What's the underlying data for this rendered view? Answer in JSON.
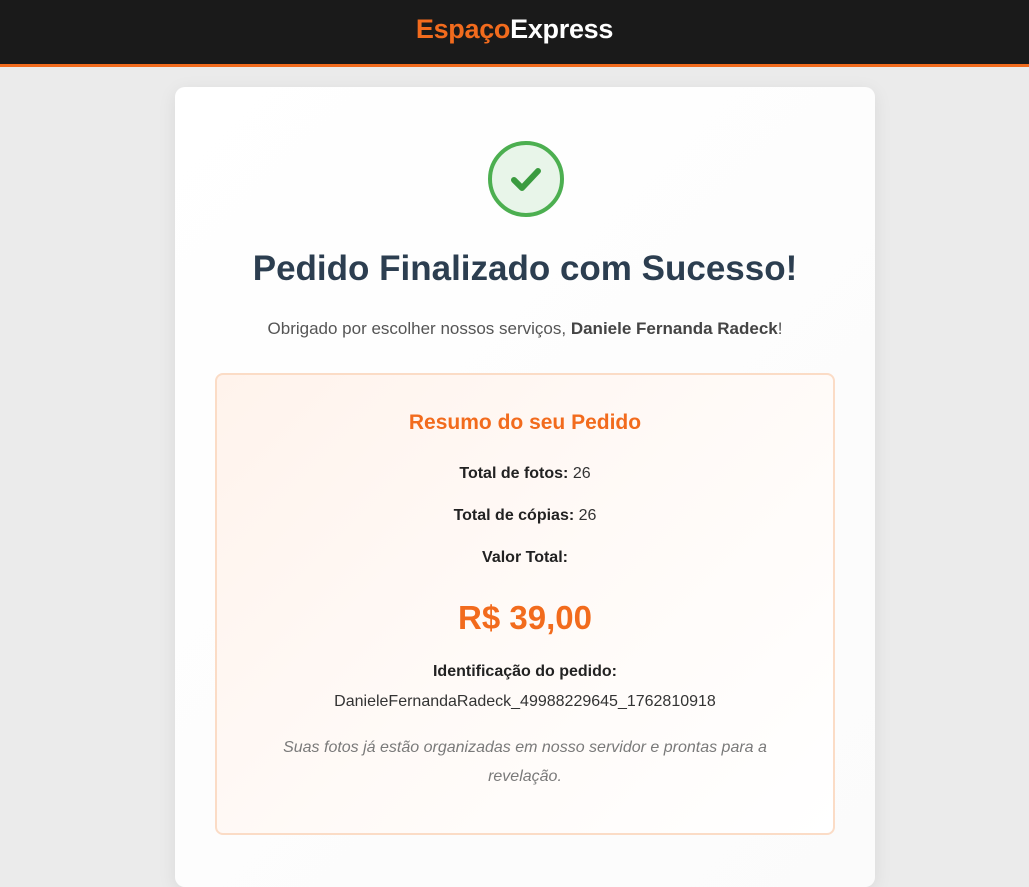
{
  "header": {
    "logo_part1": "Espaço",
    "logo_part2": "Express"
  },
  "success_icon": "check-circle-icon",
  "colors": {
    "accent": "#f26b1d",
    "success": "#4caf50",
    "title": "#2c3e50",
    "topbar": "#1a1a1a"
  },
  "main": {
    "title": "Pedido Finalizado com Sucesso!",
    "thanks_prefix": "Obrigado por escolher nossos serviços, ",
    "customer_name": "Daniele Fernanda Radeck",
    "thanks_suffix": "!"
  },
  "summary": {
    "title": "Resumo do seu Pedido",
    "photos_label": "Total de fotos:",
    "photos_value": "26",
    "copies_label": "Total de cópias:",
    "copies_value": "26",
    "total_label": "Valor Total:",
    "total_value": "R$ 39,00",
    "order_id_label": "Identificação do pedido:",
    "order_id_value": "DanieleFernandaRadeck_49988229645_1762810918",
    "note": "Suas fotos já estão organizadas em nosso servidor e prontas para a revelação."
  }
}
